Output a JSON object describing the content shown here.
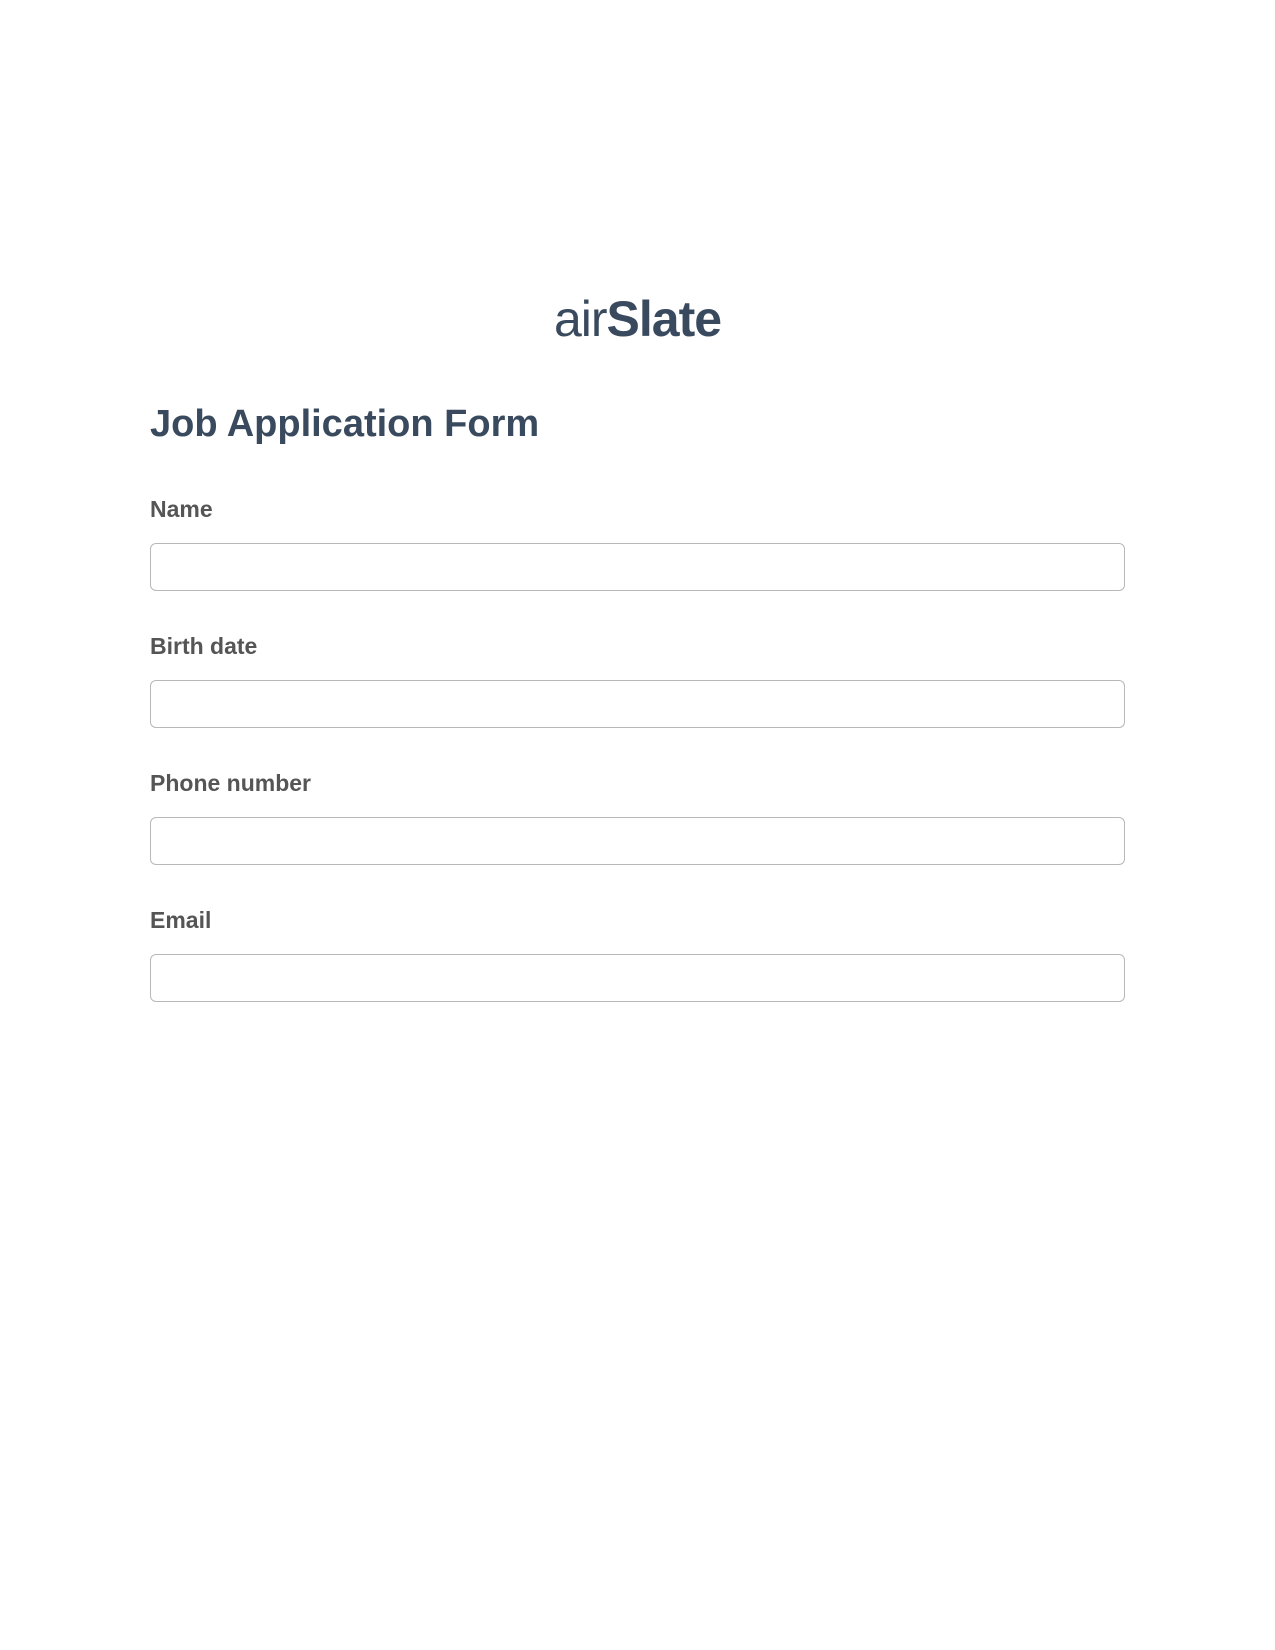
{
  "logo": {
    "prefix": "air",
    "suffix": "Slate"
  },
  "form": {
    "title": "Job Application Form",
    "fields": [
      {
        "label": "Name",
        "value": ""
      },
      {
        "label": "Birth date",
        "value": ""
      },
      {
        "label": "Phone number",
        "value": ""
      },
      {
        "label": "Email",
        "value": ""
      }
    ]
  }
}
